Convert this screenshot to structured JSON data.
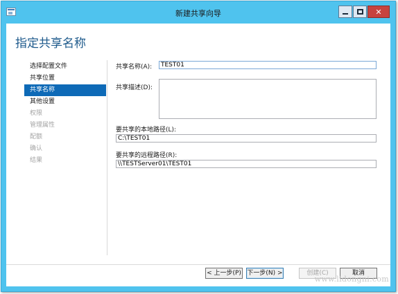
{
  "window": {
    "title": "新建共享向导",
    "icon": "wizard-app-icon",
    "controls": {
      "minimize": "minimize-icon",
      "maximize": "maximize-icon",
      "close": "✕"
    }
  },
  "page": {
    "heading": "指定共享名称"
  },
  "nav": {
    "items": [
      {
        "label": "选择配置文件",
        "state": "normal"
      },
      {
        "label": "共享位置",
        "state": "normal"
      },
      {
        "label": "共享名称",
        "state": "active"
      },
      {
        "label": "其他设置",
        "state": "normal"
      },
      {
        "label": "权限",
        "state": "disabled"
      },
      {
        "label": "管理属性",
        "state": "disabled"
      },
      {
        "label": "配额",
        "state": "disabled"
      },
      {
        "label": "确认",
        "state": "disabled"
      },
      {
        "label": "结果",
        "state": "disabled"
      }
    ]
  },
  "form": {
    "share_name_label": "共享名称(A):",
    "share_name_value": "TEST01",
    "share_desc_label": "共享描述(D):",
    "share_desc_value": "",
    "local_path_label": "要共享的本地路径(L):",
    "local_path_value": "C:\\TEST01",
    "remote_path_label": "要共享的远程路径(R):",
    "remote_path_value": "\\\\TESTServer01\\TEST01"
  },
  "buttons": {
    "prev": "< 上一步(P)",
    "next": "下一步(N) >",
    "create": "创建(C)",
    "cancel": "取消"
  },
  "watermark": "www.lidongni.com",
  "colors": {
    "titlebar": "#4fc3ee",
    "accent": "#0e6ab7",
    "heading": "#1e5a8c",
    "close": "#c7433f"
  }
}
